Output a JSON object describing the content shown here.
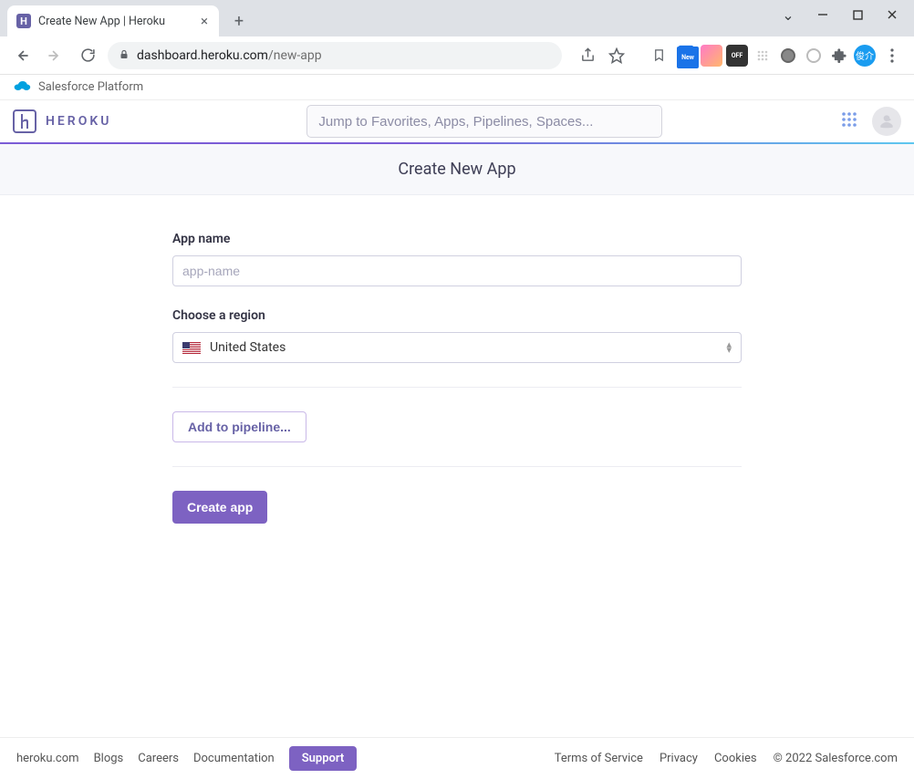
{
  "browser": {
    "tab_title": "Create New App | Heroku",
    "url_host": "dashboard.heroku.com",
    "url_path": "/new-app",
    "ext_new_label": "New",
    "ext_off_label": "OFF",
    "avatar_text": "俊介"
  },
  "salesforce_bar": {
    "label": "Salesforce Platform"
  },
  "header": {
    "logo_text": "HEROKU",
    "search_placeholder": "Jump to Favorites, Apps, Pipelines, Spaces..."
  },
  "page": {
    "title": "Create New App",
    "app_name_label": "App name",
    "app_name_placeholder": "app-name",
    "app_name_value": "",
    "region_label": "Choose a region",
    "region_selected": "United States",
    "pipeline_btn": "Add to pipeline...",
    "create_btn": "Create app"
  },
  "footer": {
    "links_left": [
      "heroku.com",
      "Blogs",
      "Careers",
      "Documentation"
    ],
    "support": "Support",
    "links_right": [
      "Terms of Service",
      "Privacy",
      "Cookies"
    ],
    "copyright": "© 2022 Salesforce.com"
  }
}
